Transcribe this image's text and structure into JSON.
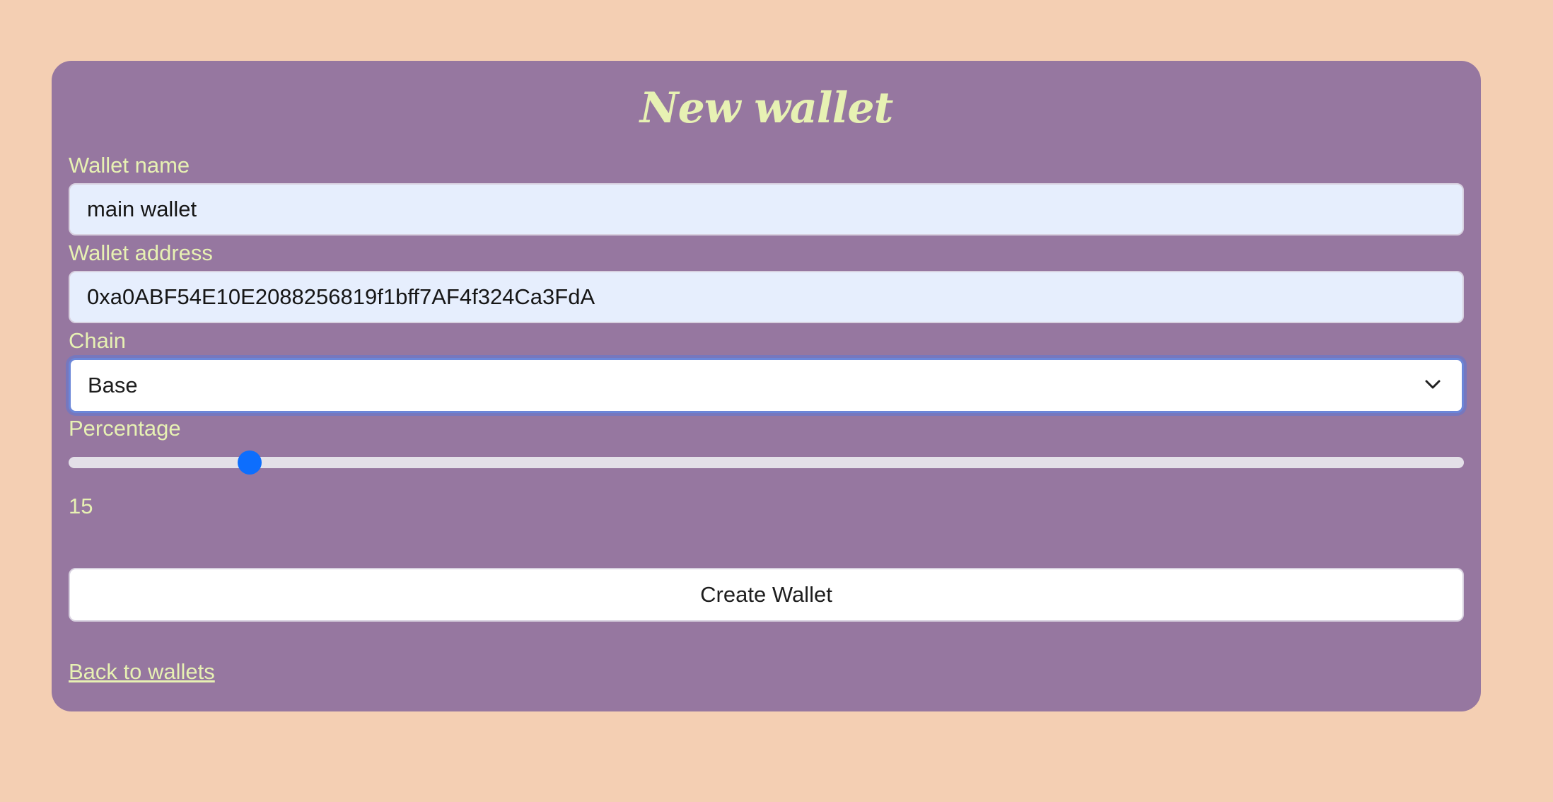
{
  "form": {
    "title": "New wallet",
    "wallet_name": {
      "label": "Wallet name",
      "value": "main wallet"
    },
    "wallet_address": {
      "label": "Wallet address",
      "value": "0xa0ABF54E10E2088256819f1bff7AF4f324Ca3FdA"
    },
    "chain": {
      "label": "Chain",
      "value": "Base",
      "icon": "chevron-down-icon"
    },
    "percentage": {
      "label": "Percentage",
      "value": "15",
      "fraction": 0.13
    },
    "submit_label": "Create Wallet",
    "back_link_label": "Back to wallets"
  },
  "colors": {
    "page_background": "#f4cfb3",
    "card_background": "#9677a0",
    "label_text": "#e7f1b3",
    "input_background": "#e6eefd",
    "focus_ring": "#6b86d8",
    "slider_thumb": "#0d6efd",
    "slider_track": "#e3e0e8"
  }
}
